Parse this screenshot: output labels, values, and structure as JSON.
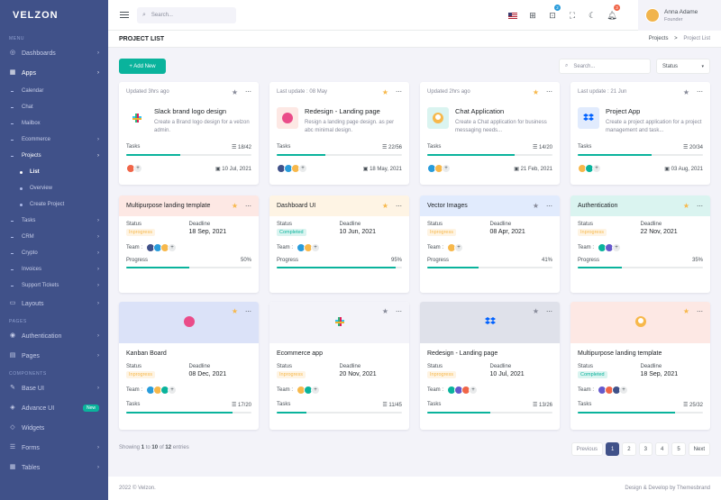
{
  "brand": "VELZON",
  "sidebar": {
    "menu_title": "MENU",
    "pages_title": "PAGES",
    "components_title": "COMPONENTS",
    "dashboards": "Dashboards",
    "apps": "Apps",
    "calendar": "Calendar",
    "chat": "Chat",
    "mailbox": "Mailbox",
    "ecommerce": "Ecommerce",
    "projects": "Projects",
    "list": "List",
    "overview": "Overview",
    "create_project": "Create Project",
    "tasks": "Tasks",
    "crm": "CRM",
    "crypto": "Crypto",
    "invoices": "Invoices",
    "support": "Support Tickets",
    "layouts": "Layouts",
    "authentication": "Authentication",
    "pages": "Pages",
    "base_ui": "Base UI",
    "advance_ui": "Advance UI",
    "new_badge": "New",
    "widgets": "Widgets",
    "forms": "Forms",
    "tables": "Tables"
  },
  "topbar": {
    "search_placeholder": "Search...",
    "cart_count": "2",
    "notif_count": "3",
    "user_name": "Anna Adame",
    "user_role": "Founder"
  },
  "page": {
    "title": "PROJECT LIST",
    "bc_parent": "Projects",
    "bc_sep": ">",
    "bc_current": "Project List",
    "add_new": "+ Add New",
    "search_placeholder": "Search...",
    "status_select": "Status"
  },
  "labels": {
    "tasks": "Tasks",
    "status": "Status",
    "deadline": "Deadline",
    "team": "Team :",
    "progress": "Progress"
  },
  "row1": [
    {
      "updated": "Updated 3hrs ago",
      "name": "Slack brand logo design",
      "desc": "Create a Brand logo design for a velzon admin.",
      "tasks": "18/42",
      "progress": 0.43,
      "date": "10 Jul, 2021",
      "starred": false
    },
    {
      "updated": "Last update : 08 May",
      "name": "Redesign - Landing page",
      "desc": "Resign a landing page design. as per abc minimal design.",
      "tasks": "22/56",
      "progress": 0.39,
      "date": "18 May, 2021",
      "starred": true
    },
    {
      "updated": "Updated 2hrs ago",
      "name": "Chat Application",
      "desc": "Create a Chat application for business messaging needs...",
      "tasks": "14/20",
      "progress": 0.7,
      "date": "21 Feb, 2021",
      "starred": true
    },
    {
      "updated": "Last update : 21 Jun",
      "name": "Project App",
      "desc": "Create a project application for a project management and task...",
      "tasks": "20/34",
      "progress": 0.59,
      "date": "03 Aug, 2021",
      "starred": false
    }
  ],
  "row2": [
    {
      "title": "Multipurpose landing template",
      "status": "Inprogress",
      "deadline": "18 Sep, 2021",
      "progress_text": "50%",
      "progress": 0.5,
      "color": "#fde8e4",
      "starred": true
    },
    {
      "title": "Dashboard UI",
      "status": "Completed",
      "deadline": "10 Jun, 2021",
      "progress_text": "95%",
      "progress": 0.95,
      "color": "#fef4e4",
      "starred": true
    },
    {
      "title": "Vector Images",
      "status": "Inprogress",
      "deadline": "08 Apr, 2021",
      "progress_text": "41%",
      "progress": 0.41,
      "color": "#e1ebfd",
      "starred": false
    },
    {
      "title": "Authentication",
      "status": "Inprogress",
      "deadline": "22 Nov, 2021",
      "progress_text": "35%",
      "progress": 0.35,
      "color": "#daf4f0",
      "starred": true
    }
  ],
  "row3": [
    {
      "name": "Kanban Board",
      "status": "Inprogress",
      "deadline": "08 Dec, 2021",
      "tasks": "17/20",
      "progress": 0.85,
      "color": "#dbe2f8",
      "starred": true
    },
    {
      "name": "Ecommerce app",
      "status": "Inprogress",
      "deadline": "20 Nov, 2021",
      "tasks": "11/45",
      "progress": 0.24,
      "color": "#f3f3f9",
      "starred": false
    },
    {
      "name": "Redesign - Landing page",
      "status": "Inprogress",
      "deadline": "10 Jul, 2021",
      "tasks": "13/26",
      "progress": 0.5,
      "color": "#dfe1ea",
      "starred": false
    },
    {
      "name": "Multipurpose landing template",
      "status": "Completed",
      "deadline": "18 Sep, 2021",
      "tasks": "25/32",
      "progress": 0.78,
      "color": "#fde8e4",
      "starred": true
    }
  ],
  "pagination": {
    "showing_prefix": "Showing ",
    "showing_from": "1",
    "showing_mid": " to ",
    "showing_to": "10",
    "showing_of": " of ",
    "showing_total": "12",
    "showing_suffix": " entries",
    "previous": "Previous",
    "pages": [
      "1",
      "2",
      "3",
      "4",
      "5"
    ],
    "next": "Next"
  },
  "footer": {
    "copyright": "2022 © Velzon.",
    "credit": "Design & Develop by Themesbrand"
  },
  "colors": {
    "primary": "#405189",
    "success": "#0ab39c",
    "warning": "#f7b84b",
    "danger": "#f06548"
  }
}
